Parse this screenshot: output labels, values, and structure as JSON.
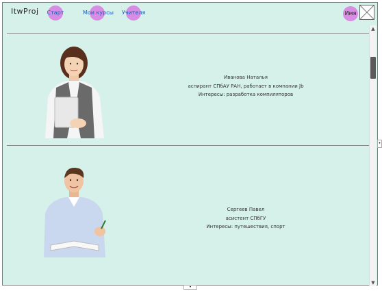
{
  "header": {
    "brand": "ItwProj",
    "nav": [
      {
        "label": "Старт"
      },
      {
        "label": "Мои курсы"
      },
      {
        "label": "Учителя"
      }
    ],
    "user_label": "Имя"
  },
  "profiles": [
    {
      "name": "Иванова Наталья",
      "position": "аспирант СПбАУ РАН, работает в компании Jb",
      "interests": "Интересы: разработка компиляторов"
    },
    {
      "name": "Сергеев Павел",
      "position": "асистент СПбГУ",
      "interests": "Интересы: путешествия, спорт"
    }
  ],
  "colors": {
    "background": "#d5f1ea",
    "bubble": "#d98ce3",
    "link": "#1a5fb4"
  },
  "icons": {
    "avatar_placeholder": "image-placeholder-icon",
    "scroll_up": "chevron-up-icon",
    "scroll_down": "chevron-down-icon"
  }
}
